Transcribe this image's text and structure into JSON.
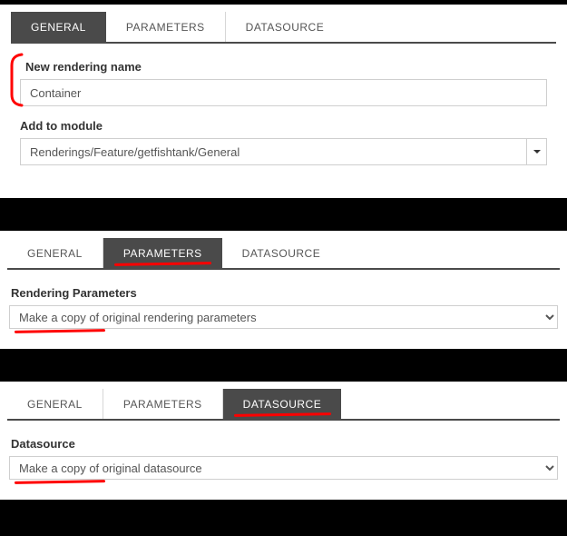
{
  "tabs": {
    "general": "GENERAL",
    "parameters": "PARAMETERS",
    "datasource": "DATASOURCE"
  },
  "section1": {
    "rendering_name_label": "New rendering name",
    "rendering_name_value": "Container",
    "add_to_module_label": "Add to module",
    "add_to_module_value": "Renderings/Feature/getfishtank/General"
  },
  "section2": {
    "rendering_params_label": "Rendering Parameters",
    "rendering_params_value": "Make a copy of original rendering parameters"
  },
  "section3": {
    "datasource_label": "Datasource",
    "datasource_value": "Make a copy of original datasource"
  }
}
